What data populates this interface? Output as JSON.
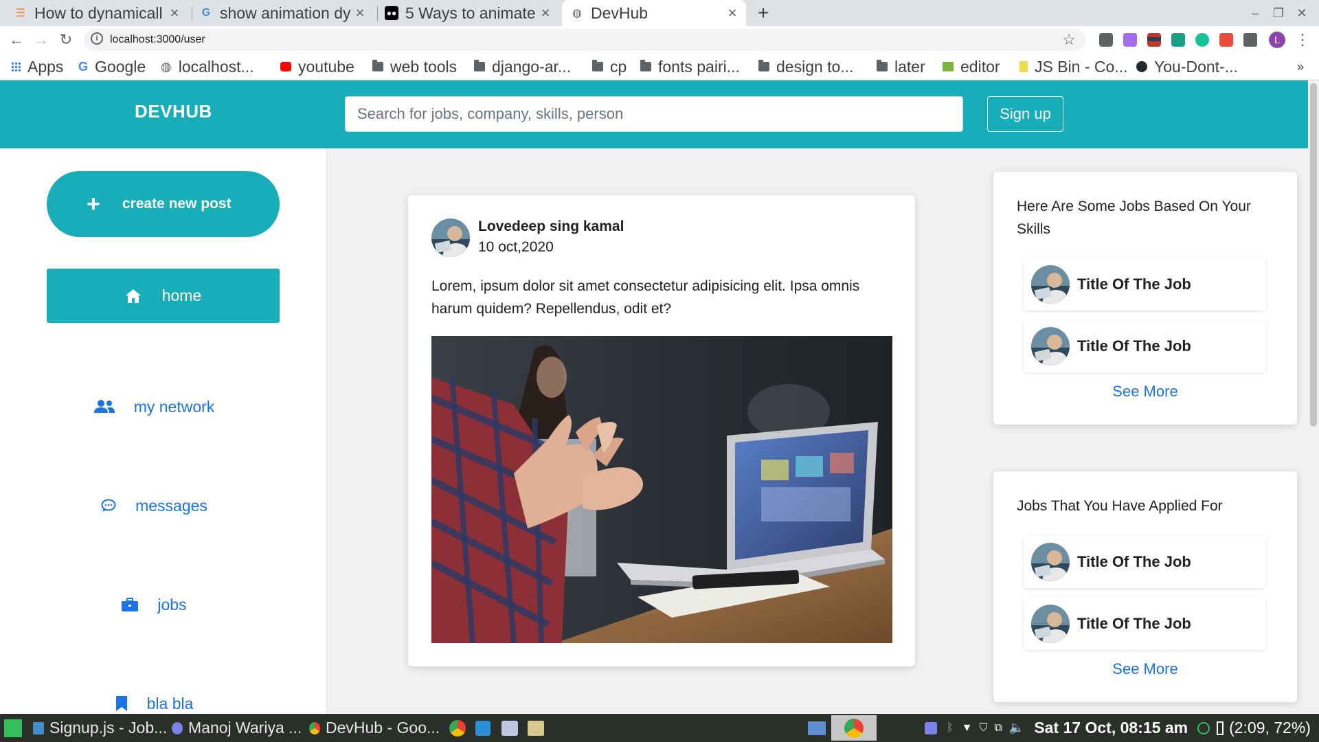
{
  "browser": {
    "tabs": [
      {
        "title": "How to dynamicall",
        "icon": "stackoverflow-icon"
      },
      {
        "title": "show animation dy",
        "icon": "google-icon"
      },
      {
        "title": "5 Ways to animate",
        "icon": "medium-icon"
      },
      {
        "title": "DevHub",
        "icon": "globe-icon",
        "active": true
      }
    ],
    "url": "localhost:3000/user",
    "profile_initial": "L",
    "bookmarks": [
      {
        "label": "Apps",
        "icon": "apps-grid-icon"
      },
      {
        "label": "Google",
        "icon": "google-icon"
      },
      {
        "label": "localhost...",
        "icon": "globe-icon"
      },
      {
        "label": "youtube",
        "icon": "youtube-icon"
      },
      {
        "label": "web tools",
        "icon": "folder-icon"
      },
      {
        "label": "django-ar...",
        "icon": "folder-icon"
      },
      {
        "label": "cp",
        "icon": "folder-icon"
      },
      {
        "label": "fonts pairi...",
        "icon": "folder-icon"
      },
      {
        "label": "design to...",
        "icon": "folder-icon"
      },
      {
        "label": "later",
        "icon": "folder-icon"
      },
      {
        "label": "editor",
        "icon": "editor-icon"
      },
      {
        "label": "JS Bin - Co...",
        "icon": "jsbin-icon"
      },
      {
        "label": "You-Dont-...",
        "icon": "github-icon"
      }
    ],
    "more_bookmarks": "»"
  },
  "header": {
    "brand": "DEVHUB",
    "search_placeholder": "Search for jobs, company, skills, person",
    "signup_label": "Sign up"
  },
  "sidebar": {
    "create_label": "create new post",
    "items": [
      {
        "label": "home",
        "icon": "home-icon"
      },
      {
        "label": "my network",
        "icon": "users-icon"
      },
      {
        "label": "messages",
        "icon": "chat-icon"
      },
      {
        "label": "jobs",
        "icon": "briefcase-icon"
      },
      {
        "label": "bla bla",
        "icon": "bookmark-icon"
      }
    ]
  },
  "post": {
    "author": "Lovedeep sing kamal",
    "date": "10 oct,2020",
    "text": "Lorem, ipsum dolor sit amet consectetur adipisicing elit. Ipsa omnis harum quidem? Repellendus, odit et?"
  },
  "jobs_recommended": {
    "heading": "Here Are Some Jobs Based On Your Skills",
    "items": [
      "Title Of The Job",
      "Title Of The Job"
    ],
    "see_more": "See More"
  },
  "jobs_applied": {
    "heading": "Jobs That You Have Applied For",
    "items": [
      "Title Of The Job",
      "Title Of The Job"
    ],
    "see_more": "See More"
  },
  "taskbar": {
    "items": [
      {
        "label": "Signup.js - Job...",
        "icon": "vscode-icon"
      },
      {
        "label": "Manoj Wariya ...",
        "icon": "teams-icon"
      },
      {
        "label": "DevHub - Goo...",
        "icon": "chrome-icon"
      }
    ],
    "clock": "Sat 17 Oct, 08:15 am",
    "battery": "(2:09, 72%)"
  },
  "colors": {
    "accent": "#17adb9",
    "link": "#1a73e8"
  }
}
